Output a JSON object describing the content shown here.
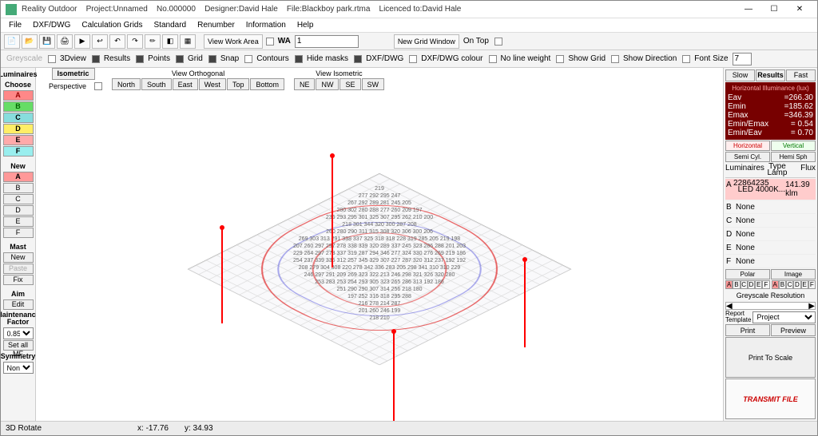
{
  "title": {
    "app": "Reality Outdoor",
    "project": "Project:Unnamed",
    "no": "No.000000",
    "designer": "Designer:David Hale",
    "file": "File:Blackboy park.rtma",
    "licence": "Licenced to:David Hale"
  },
  "winbtns": {
    "min": "—",
    "max": "☐",
    "close": "✕"
  },
  "menubar": [
    "File",
    "DXF/DWG",
    "Calculation Grids",
    "Standard",
    "Renumber",
    "Information",
    "Help"
  ],
  "toolbar1": {
    "view_work_area": "View Work Area",
    "wa_label": "WA",
    "wa_value": "1",
    "new_grid": "New Grid Window",
    "on_top": "On Top"
  },
  "toolbar2": {
    "greyscale": "Greyscale",
    "d3view": "3Dview",
    "results": "Results",
    "points": "Points",
    "grid": "Grid",
    "snap": "Snap",
    "contours": "Contours",
    "hide_masks": "Hide masks",
    "dxf": "DXF/DWG",
    "dxf_colour": "DXF/DWG colour",
    "no_line_weight": "No line weight",
    "show_grid": "Show Grid",
    "show_direction": "Show Direction",
    "font_size": "Font Size",
    "font_size_val": "7"
  },
  "left": {
    "luminaires": "Luminaires",
    "choose": "Choose",
    "letters": [
      "A",
      "B",
      "C",
      "D",
      "E",
      "F"
    ],
    "new": "New",
    "mast": "Mast",
    "new_mast": "New",
    "paste": "Paste",
    "fix": "Fix",
    "aim": "Aim",
    "edit": "Edit",
    "mf": "Maintenance\nFactor",
    "mf_val": "0.85",
    "set_all_mf": "Set all MF",
    "symmetry": "Symmetry",
    "symmetry_val": "None"
  },
  "view": {
    "isometric": "Isometric",
    "perspective": "Perspective",
    "view_ortho": "View Orthogonal",
    "view_iso": "View Isometric",
    "north": "North",
    "south": "South",
    "east": "East",
    "west": "West",
    "top": "Top",
    "bottom": "Bottom",
    "ne": "NE",
    "nw": "NW",
    "se": "SE",
    "sw": "SW"
  },
  "right": {
    "slow": "Slow",
    "results": "Results",
    "fast": "Fast",
    "res_title": "Horizontal Illuminance (lux)",
    "rows": [
      {
        "k": "Eav",
        "v": "=266.30"
      },
      {
        "k": "Emin",
        "v": "=185.62"
      },
      {
        "k": "Emax",
        "v": "=346.39"
      },
      {
        "k": "Emin/Emax",
        "v": "= 0.54"
      },
      {
        "k": "Emin/Eav",
        "v": "= 0.70"
      }
    ],
    "horizontal": "Horizontal",
    "vertical": "Vertical",
    "semi_cyl": "Semi Cyl.",
    "hemi_sph": "Hemi Sph",
    "lum_header": {
      "lum": "Luminaires",
      "type": "Type\nLamp",
      "flux": "Flux"
    },
    "lum_rows": [
      {
        "id": "A",
        "type": "22864235\n  LED 4000K...",
        "flux": "141.39 klm",
        "active": true
      },
      {
        "id": "B",
        "type": "None",
        "flux": ""
      },
      {
        "id": "C",
        "type": "None",
        "flux": ""
      },
      {
        "id": "D",
        "type": "None",
        "flux": ""
      },
      {
        "id": "E",
        "type": "None",
        "flux": ""
      },
      {
        "id": "F",
        "type": "None",
        "flux": ""
      }
    ],
    "polar": "Polar",
    "image": "Image",
    "letters": [
      "A",
      "B",
      "C",
      "D",
      "E",
      "F"
    ],
    "grey_res": "Greyscale Resolution",
    "report_tpl": "Report\nTemplate",
    "report_val": "Project",
    "print": "Print",
    "preview": "Preview",
    "print_scale": "Print To Scale",
    "transmit": "TRANSMIT FILE"
  },
  "status": {
    "mode": "3D Rotate",
    "x": "x: -17.76",
    "y": "y: 34.93"
  },
  "numbers": "219\n277 292 295 247\n267 292 289 281 245 205\n280 302 280 288 277 260 209 197\n236 293 295 301 325 307 295 262 210 200\n218 301 344 320 300 287 208\n260 280 290 311 315 308 320 306 300 206\n269 303 313 291 338 337 325 318 318 228 319 285 205 219 198\n207 260 297 297 278 338 339 320 289 337 245 323 286 288 201 203\n229 264 297 273 337 319 287 294 346 277 324 330 276 269 219 186\n254 237 339 335 312 257 345 329 307 227 287 320 312 237 192 192\n208 279 304 308 220 278 342 336 283 205 298 341 310 310 229\n246 297 291 209 269 323 322 213 246 298 321 326 320 280\n253 283 253 254 293 305 323 265 286 313 192 186\n251 290 290 307 314 256 218 180\n197 252 316 318 295 288\n216 278 214 287\n201 260 246 199\n218 210"
}
